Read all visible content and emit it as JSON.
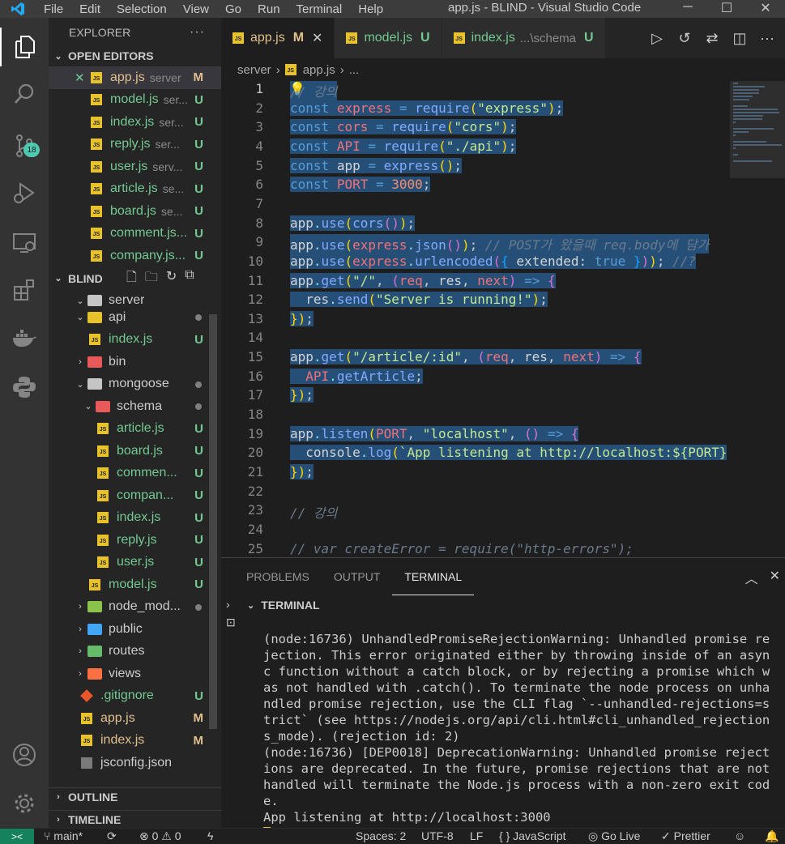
{
  "window": {
    "title": "app.js - BLIND - Visual Studio Code",
    "menu": [
      "File",
      "Edit",
      "Selection",
      "View",
      "Go",
      "Run",
      "Terminal",
      "Help"
    ],
    "controls": [
      "─",
      "☐",
      "✕"
    ]
  },
  "activity_bar": {
    "scm_badge": "18"
  },
  "explorer": {
    "title": "EXPLORER",
    "more": "···",
    "open_editors_label": "OPEN EDITORS",
    "open_editors": [
      {
        "name": "app.js",
        "desc": "server",
        "status": "M"
      },
      {
        "name": "model.js",
        "desc": "ser...",
        "status": "U"
      },
      {
        "name": "index.js",
        "desc": "ser...",
        "status": "U"
      },
      {
        "name": "reply.js",
        "desc": "ser...",
        "status": "U"
      },
      {
        "name": "user.js",
        "desc": "serv...",
        "status": "U"
      },
      {
        "name": "article.js",
        "desc": "se...",
        "status": "U"
      },
      {
        "name": "board.js",
        "desc": "se...",
        "status": "U"
      },
      {
        "name": "comment.js...",
        "desc": "",
        "status": "U"
      },
      {
        "name": "company.js...",
        "desc": "",
        "status": "U"
      }
    ],
    "workspace_label": "BLIND",
    "tree": [
      {
        "name": "server",
        "type": "folder"
      },
      {
        "name": "api",
        "type": "folder"
      },
      {
        "name": "index.js",
        "status": "U"
      },
      {
        "name": "bin",
        "type": "folder"
      },
      {
        "name": "mongoose",
        "type": "folder"
      },
      {
        "name": "schema",
        "type": "folder"
      },
      {
        "name": "article.js",
        "status": "U"
      },
      {
        "name": "board.js",
        "status": "U"
      },
      {
        "name": "commen...",
        "status": "U"
      },
      {
        "name": "compan...",
        "status": "U"
      },
      {
        "name": "index.js",
        "status": "U"
      },
      {
        "name": "reply.js",
        "status": "U"
      },
      {
        "name": "user.js",
        "status": "U"
      },
      {
        "name": "model.js",
        "status": "U"
      },
      {
        "name": "node_mod...",
        "type": "folder"
      },
      {
        "name": "public",
        "type": "folder"
      },
      {
        "name": "routes",
        "type": "folder"
      },
      {
        "name": "views",
        "type": "folder"
      },
      {
        "name": ".gitignore",
        "status": "U"
      },
      {
        "name": "app.js",
        "status": "M"
      },
      {
        "name": "index.js",
        "status": "M"
      },
      {
        "name": "jsconfig.json",
        "status": ""
      }
    ],
    "outline_label": "OUTLINE",
    "timeline_label": "TIMELINE"
  },
  "tabs": [
    {
      "name": "app.js",
      "status": "M",
      "desc": ""
    },
    {
      "name": "model.js",
      "status": "U",
      "desc": ""
    },
    {
      "name": "index.js",
      "status": "U",
      "desc": "...\\schema"
    }
  ],
  "breadcrumb": [
    "server",
    "›",
    "app.js",
    "›",
    "..."
  ],
  "code_lines": [
    {
      "n": "1",
      "text": "// 강의"
    },
    {
      "n": "2",
      "text": "const express = require(\"express\");"
    },
    {
      "n": "3",
      "text": "const cors = require(\"cors\");"
    },
    {
      "n": "4",
      "text": "const API = require(\"./api\");"
    },
    {
      "n": "5",
      "text": "const app = express();"
    },
    {
      "n": "6",
      "text": "const PORT = 3000;"
    },
    {
      "n": "7",
      "text": ""
    },
    {
      "n": "8",
      "text": "app.use(cors());"
    },
    {
      "n": "9",
      "text": "app.use(express.json()); // POST가 왔을때 req.body에 담가"
    },
    {
      "n": "10",
      "text": "app.use(express.urlencoded({ extended: true })); //?"
    },
    {
      "n": "11",
      "text": "app.get(\"/\", (req, res, next) => {"
    },
    {
      "n": "12",
      "text": "  res.send(\"Server is running!\");"
    },
    {
      "n": "13",
      "text": "});"
    },
    {
      "n": "14",
      "text": ""
    },
    {
      "n": "15",
      "text": "app.get(\"/article/:id\", (req, res, next) => {"
    },
    {
      "n": "16",
      "text": "  API.getArticle;"
    },
    {
      "n": "17",
      "text": "});"
    },
    {
      "n": "18",
      "text": ""
    },
    {
      "n": "19",
      "text": "app.listen(PORT, \"localhost\", () => {"
    },
    {
      "n": "20",
      "text": "  console.log(`App listening at http://localhost:${PORT}"
    },
    {
      "n": "21",
      "text": "});"
    },
    {
      "n": "22",
      "text": ""
    },
    {
      "n": "23",
      "text": "// 강의"
    },
    {
      "n": "24",
      "text": ""
    },
    {
      "n": "25",
      "text": "// var createError = require(\"http-errors\");"
    }
  ],
  "panel": {
    "tabs": [
      "PROBLEMS",
      "OUTPUT",
      "TERMINAL"
    ],
    "active": "TERMINAL",
    "terminal_label": "TERMINAL",
    "terminal_output": "(node:16736) UnhandledPromiseRejectionWarning: Unhandled promise rejection. This error originated either by throwing inside of an async function without a catch block, or by rejecting a promise which was not handled with .catch(). To terminate the node process on unhandled promise rejection, use the CLI flag `--unhandled-rejections=strict` (see https://nodejs.org/api/cli.html#cli_unhandled_rejections_mode). (rejection id: 2)\n(node:16736) [DEP0018] DeprecationWarning: Unhandled promise rejections are deprecated. In the future, promise rejections that are not handled will terminate the Node.js process with a non-zero exit code.\nApp listening at http://localhost:3000"
  },
  "status_bar": {
    "remote": "><",
    "branch": "main*",
    "sync": "⟳",
    "problems": "⊗ 0 ⚠ 0",
    "spaces": "Spaces: 2",
    "encoding": "UTF-8",
    "eol": "LF",
    "language": "{ } JavaScript",
    "golive": "Go Live",
    "prettier": "✓ Prettier"
  },
  "colors": {
    "accent": "#007acc",
    "untracked": "#73c991",
    "modified": "#e2c08d",
    "selection": "#264f78"
  }
}
